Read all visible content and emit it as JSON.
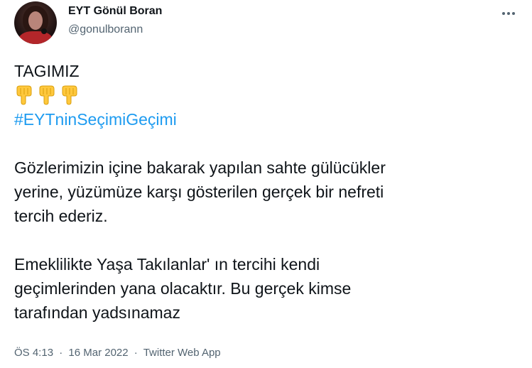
{
  "author": {
    "display_name": "EYT Gönül Boran",
    "handle": "@gonulborann",
    "avatar_icon": "user-avatar-photo"
  },
  "menu": {
    "icon": "more-dots-icon"
  },
  "tweet": {
    "line1": "TAGIMIZ",
    "emojis": [
      "backhand-index-pointing-down-emoji",
      "backhand-index-pointing-down-emoji",
      "backhand-index-pointing-down-emoji"
    ],
    "hashtag": "#EYTninSeçimiGeçimi",
    "para1": [
      "Gözlerimizin içine bakarak yapılan sahte gülücükler",
      "yerine, yüzümüze karşı gösterilen gerçek bir nefreti",
      "tercih ederiz."
    ],
    "para2": [
      "Emeklilikte Yaşa Takılanlar' ın tercihi kendi",
      "geçimlerinden yana olacaktır. Bu gerçek kimse",
      "tarafından yadsınamaz"
    ]
  },
  "meta": {
    "time": "ÖS 4:13",
    "separator": "·",
    "date": "16 Mar 2022",
    "source": "Twitter Web App"
  },
  "colors": {
    "link": "#1d9bf0",
    "secondary_text": "#536471",
    "primary_text": "#0f1419",
    "emoji_fill": "#ffc83d"
  }
}
